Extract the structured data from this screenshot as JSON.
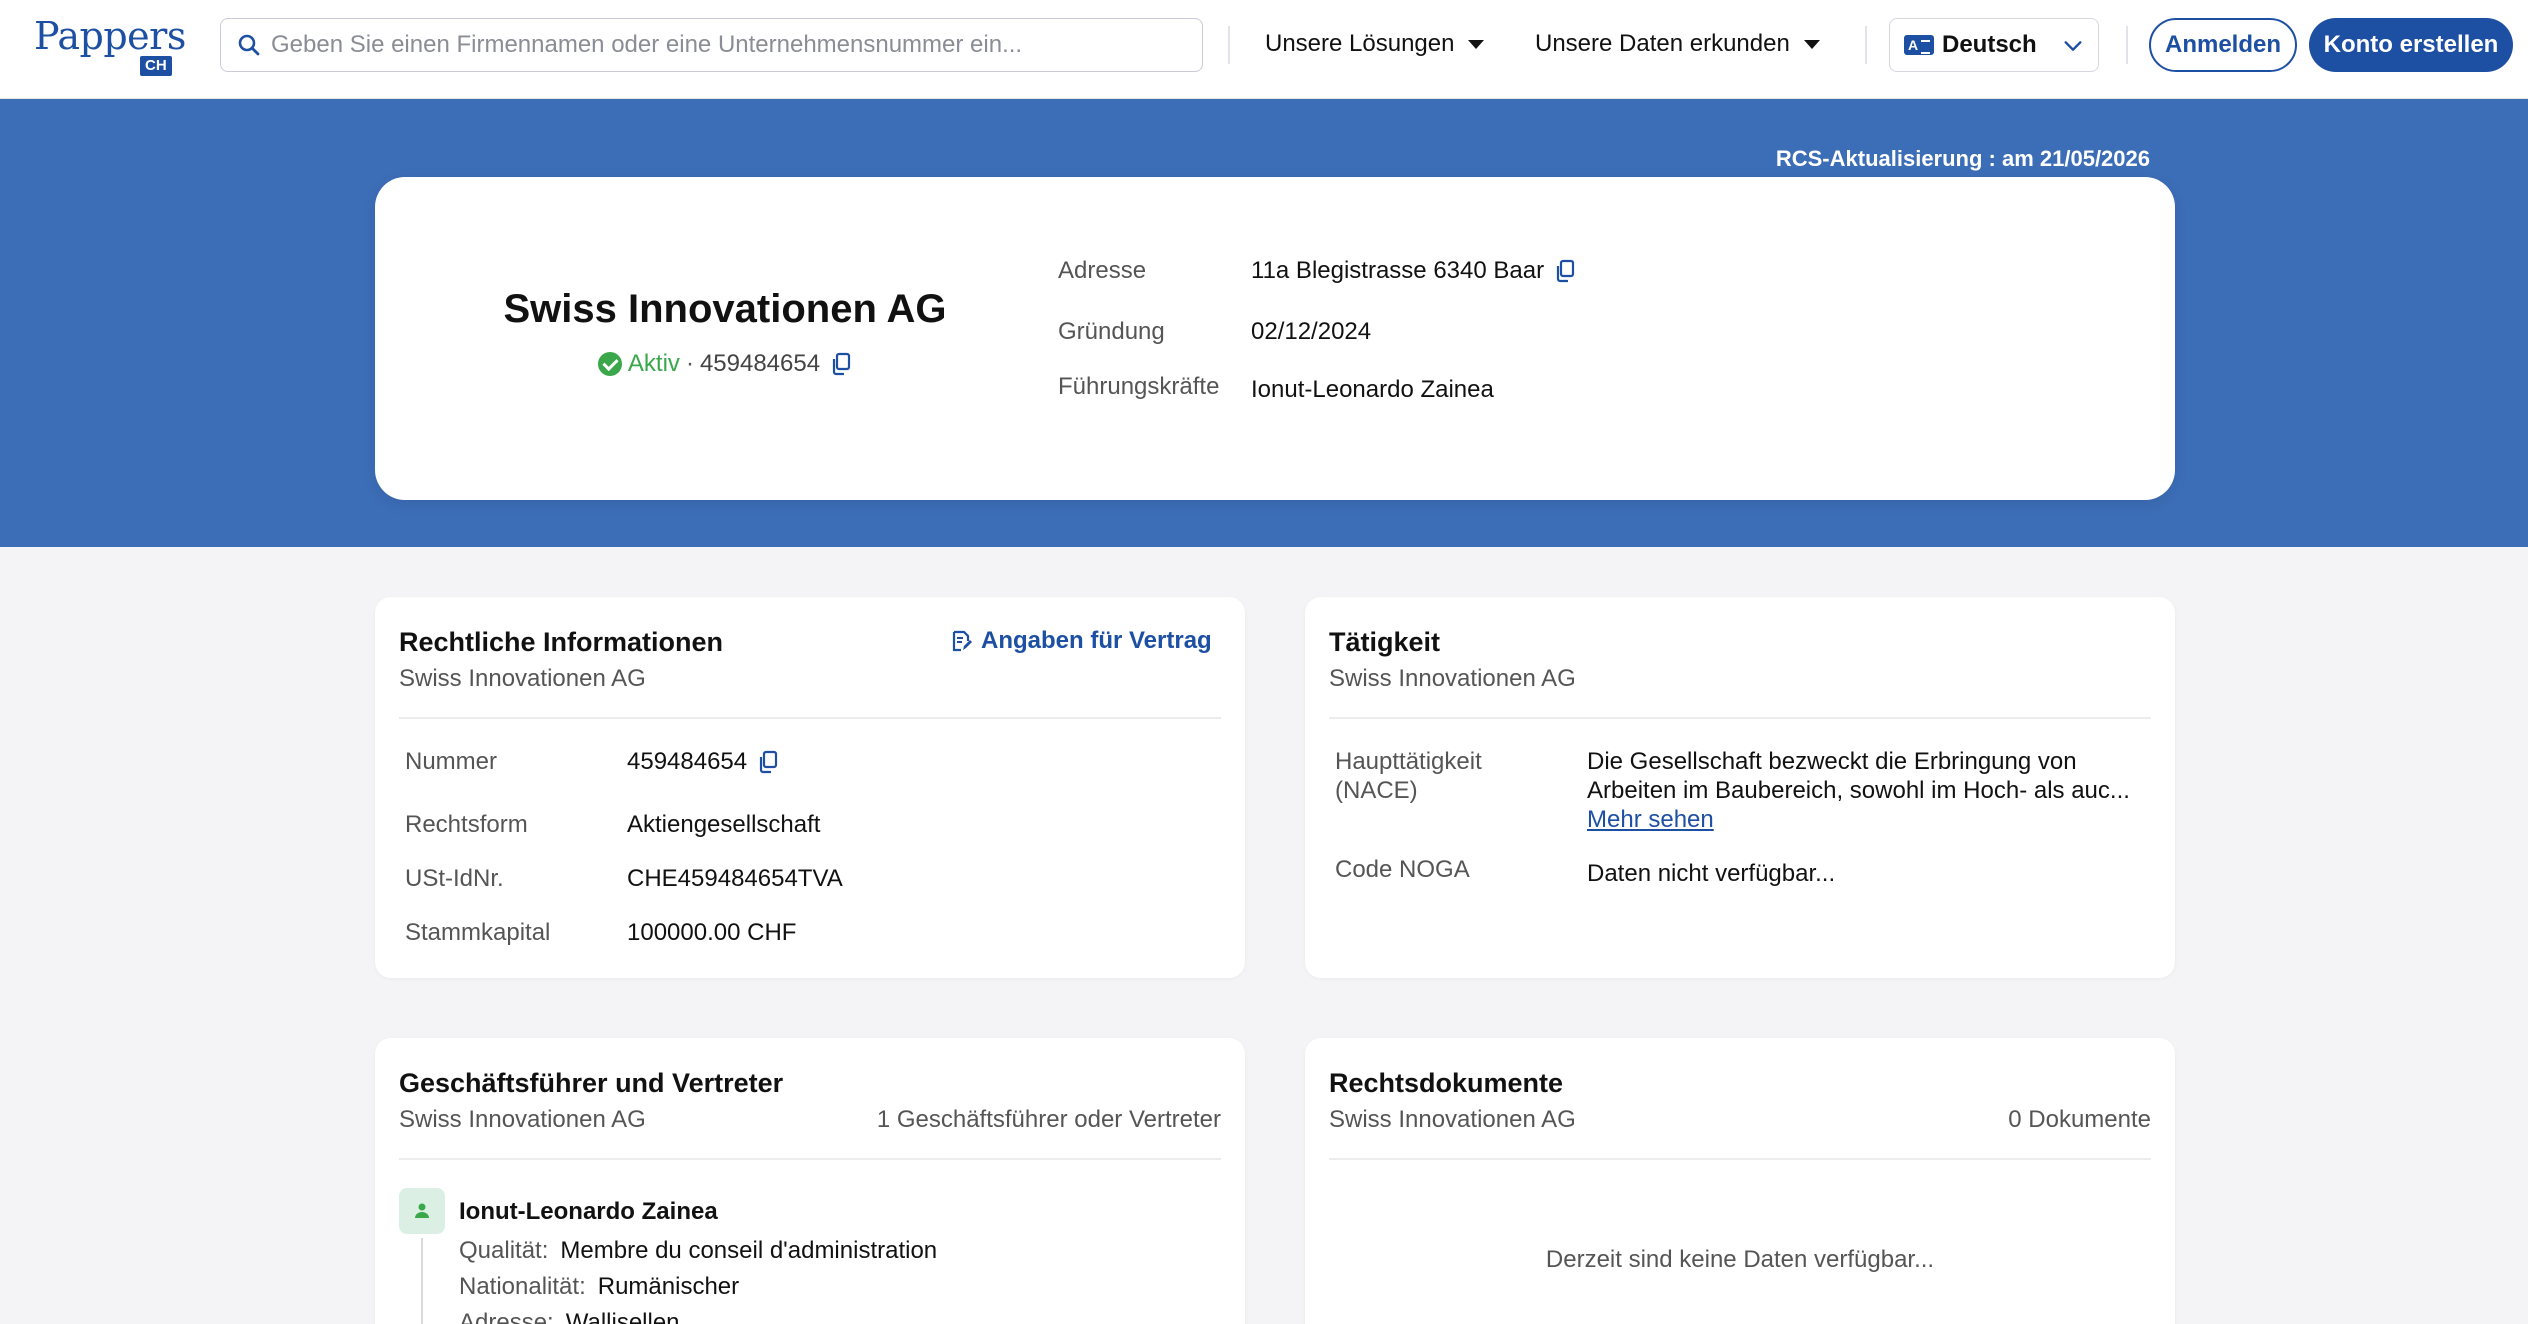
{
  "nav": {
    "logo": "Pappers",
    "logo_badge": "CH",
    "search_placeholder": "Geben Sie einen Firmennamen oder eine Unternehmensnummer ein...",
    "menu_solutions": "Unsere Lösungen",
    "menu_data": "Unsere Daten erkunden",
    "language": "Deutsch",
    "login": "Anmelden",
    "signup": "Konto erstellen"
  },
  "hero": {
    "rcs_update": "RCS-Aktualisierung : am 21/05/2026",
    "company_name": "Swiss Innovationen AG",
    "status": "Aktiv",
    "separator": "·",
    "number": "459484654",
    "fields": [
      {
        "label": "Adresse",
        "value": "11a Blegistrasse 6340 Baar"
      },
      {
        "label": "Gründung",
        "value": "02/12/2024"
      },
      {
        "label": "Führungskräfte",
        "value": "Ionut-Leonardo Zainea"
      }
    ]
  },
  "legal": {
    "title": "Rechtliche Informationen",
    "subtitle": "Swiss Innovationen AG",
    "action": "Angaben für Vertrag",
    "rows": [
      {
        "label": "Nummer",
        "value": "459484654"
      },
      {
        "label": "Rechtsform",
        "value": "Aktiengesellschaft"
      },
      {
        "label": "USt-IdNr.",
        "value": "CHE459484654TVA"
      },
      {
        "label": "Stammkapital",
        "value": "100000.00 CHF"
      }
    ]
  },
  "activity": {
    "title": "Tätigkeit",
    "subtitle": "Swiss Innovationen AG",
    "main_label_1": "Haupttätigkeit",
    "main_label_2": "(NACE)",
    "main_value": "Die Gesellschaft bezweckt die Erbringung von Arbeiten im Baubereich, sowohl im Hoch- als auc...",
    "more": "Mehr sehen",
    "noga_label": "Code NOGA",
    "noga_value": "Daten nicht verfügbar..."
  },
  "managers": {
    "title": "Geschäftsführer und Vertreter",
    "subtitle": "Swiss Innovationen AG",
    "count": "1 Geschäftsführer oder Vertreter",
    "person": {
      "name": "Ionut-Leonardo Zainea",
      "quality_label": "Qualität:",
      "quality": "Membre du conseil d'administration",
      "nationality_label": "Nationalität:",
      "nationality": "Rumänischer",
      "address_label": "Adresse:",
      "address": "Wallisellen"
    }
  },
  "documents": {
    "title": "Rechtsdokumente",
    "subtitle": "Swiss Innovationen AG",
    "count": "0 Dokumente",
    "empty": "Derzeit sind keine Daten verfügbar..."
  },
  "colors": {
    "brand": "#1d4fa3",
    "hero_bg": "#3c6db7",
    "active": "#3aa74a",
    "page_bg": "#f4f4f6"
  },
  "icons": [
    "search-icon",
    "caret-down-icon",
    "language-icon",
    "chevron-down-icon",
    "check-circle-icon",
    "copy-icon",
    "edit-document-icon",
    "person-icon"
  ]
}
